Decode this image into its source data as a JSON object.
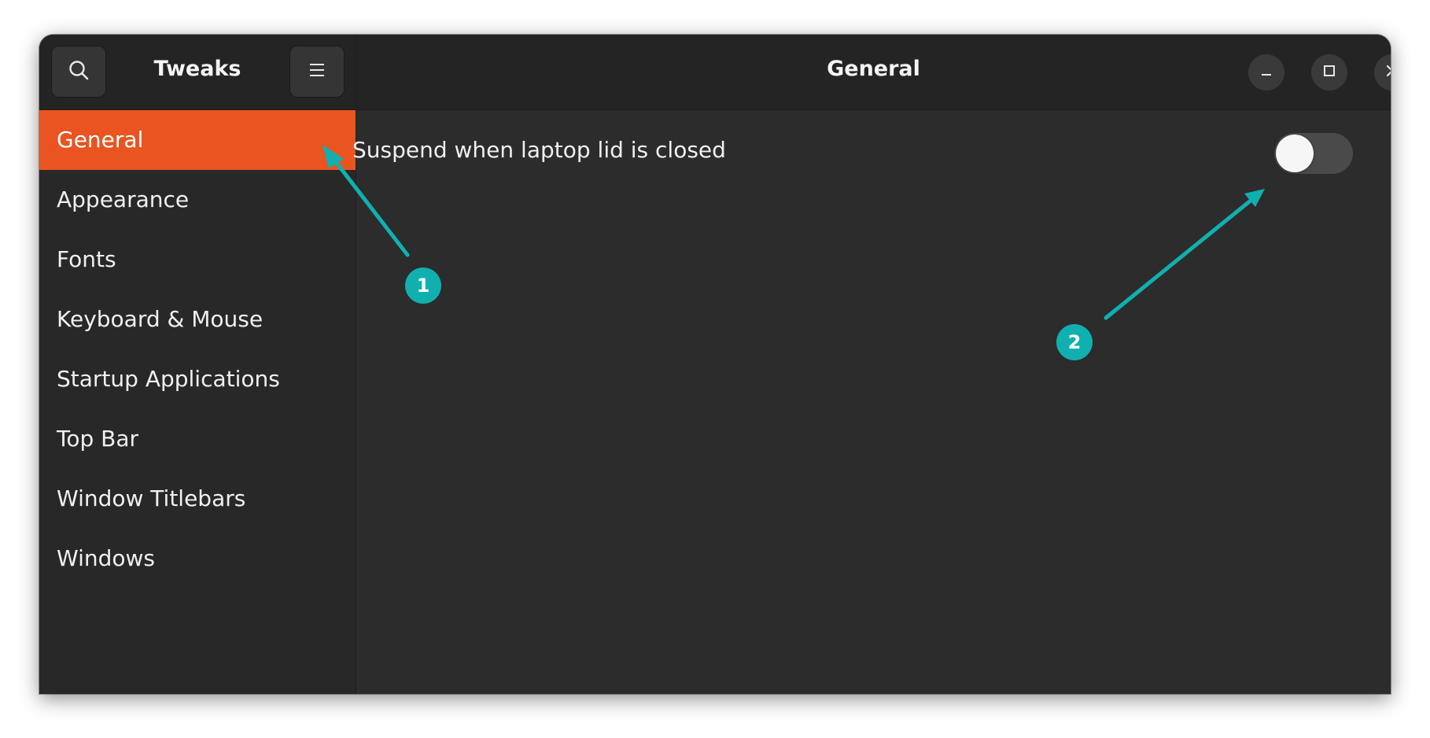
{
  "window": {
    "sidebar_title": "Tweaks",
    "main_title": "General"
  },
  "sidebar": {
    "items": [
      {
        "label": "General",
        "active": true
      },
      {
        "label": "Appearance",
        "active": false
      },
      {
        "label": "Fonts",
        "active": false
      },
      {
        "label": "Keyboard & Mouse",
        "active": false
      },
      {
        "label": "Startup Applications",
        "active": false
      },
      {
        "label": "Top Bar",
        "active": false
      },
      {
        "label": "Window Titlebars",
        "active": false
      },
      {
        "label": "Windows",
        "active": false
      }
    ]
  },
  "main": {
    "settings": [
      {
        "label": "Suspend when laptop lid is closed",
        "enabled": false
      }
    ]
  },
  "annotations": {
    "markers": [
      "1",
      "2"
    ],
    "color": "#10b0b0"
  },
  "colors": {
    "accent": "#e95420",
    "annotation": "#10b0b0"
  }
}
